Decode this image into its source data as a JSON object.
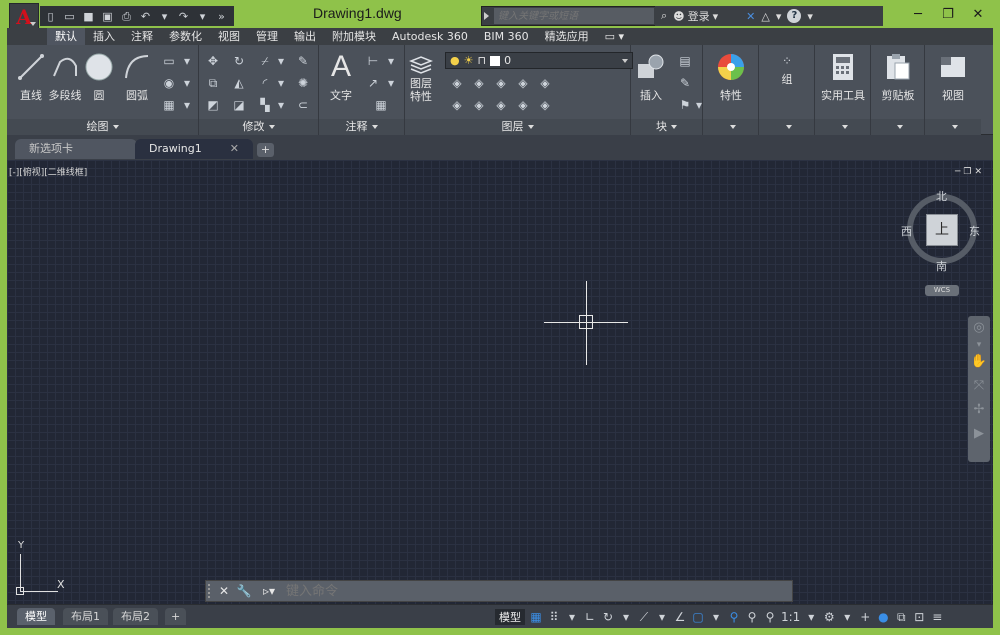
{
  "title_bar": {
    "app_letter": "A",
    "document_title": "Drawing1.dwg",
    "search_placeholder": "键入关键字或短语",
    "login_label": "登录",
    "help_label": "?"
  },
  "ribbon_tabs": [
    "默认",
    "插入",
    "注释",
    "参数化",
    "视图",
    "管理",
    "输出",
    "附加模块",
    "Autodesk 360",
    "BIM 360",
    "精选应用"
  ],
  "active_tab": "默认",
  "panels": {
    "draw": {
      "title": "绘图",
      "tools": [
        "直线",
        "多段线",
        "圆",
        "圆弧"
      ]
    },
    "modify": {
      "title": "修改"
    },
    "annotation": {
      "title": "注释",
      "text_label": "文字"
    },
    "layers": {
      "title": "图层",
      "properties_label_line1": "图层",
      "properties_label_line2": "特性",
      "current_layer": "0"
    },
    "block": {
      "title": "块",
      "insert_label": "插入"
    },
    "properties": {
      "label": "特性"
    },
    "groups": {
      "label": "组"
    },
    "utilities": {
      "label": "实用工具"
    },
    "clipboard": {
      "label": "剪贴板"
    },
    "view": {
      "label": "视图"
    }
  },
  "document_tabs": [
    {
      "label": "新选项卡",
      "active": false
    },
    {
      "label": "Drawing1",
      "active": true
    }
  ],
  "viewport": {
    "label": "[-][俯视][二维线框]"
  },
  "viewcube": {
    "top": "上",
    "north": "北",
    "south": "南",
    "east": "东",
    "west": "西",
    "wcs": "WCS"
  },
  "ucs": {
    "x": "X",
    "y": "Y"
  },
  "command_line": {
    "placeholder": "键入命令"
  },
  "layout_tabs": [
    "模型",
    "布局1",
    "布局2"
  ],
  "active_layout": "模型",
  "status_bar": {
    "model_label": "模型",
    "scale_label": "1:1"
  },
  "colors": {
    "title_bar_bg": "#8fc24a",
    "ribbon_bg": "#4b515a",
    "canvas_bg": "#222735",
    "app_button_red": "#d3101c",
    "accent_blue": "#3a8ee6"
  }
}
